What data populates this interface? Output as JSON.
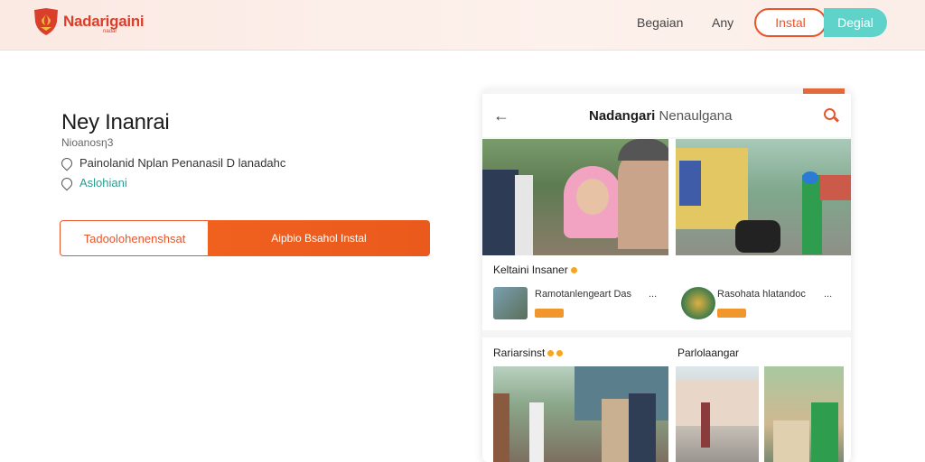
{
  "header": {
    "brand": "Nadarigaini",
    "brand_sub": "nadar",
    "nav": [
      "Begaian",
      "Any"
    ],
    "install_label": "Instal",
    "secondary_label": "Degial"
  },
  "hero": {
    "title": "Ney Inanrai",
    "subtitle": "Nioanos⁠ƞ3",
    "info_location": "Painolanid  Nplan  Penanasil D lanadahc",
    "info_link": "Aslohiani",
    "cta_left": "Tadoolohenenshsat",
    "cta_right": "Aipbio  Bsahol  Instal"
  },
  "card": {
    "title_bold": "Nadangari",
    "title_rest": "Nenaulgana",
    "post1": {
      "title": "Keltaini Insaner",
      "items": [
        {
          "label": "Ramotanlengeart Das",
          "more": "..."
        },
        {
          "label": "Rasohata hlatandoc",
          "more": "..."
        }
      ]
    },
    "post2": {
      "titles": [
        "Rariarsinst",
        "Parlolaangar"
      ]
    }
  },
  "colors": {
    "accent": "#e8552b",
    "teal": "#5fd3c9",
    "brand": "#d8402b"
  },
  "icons": [
    "shield-logo-icon",
    "location-pin-icon",
    "back-arrow-icon",
    "search-icon"
  ]
}
